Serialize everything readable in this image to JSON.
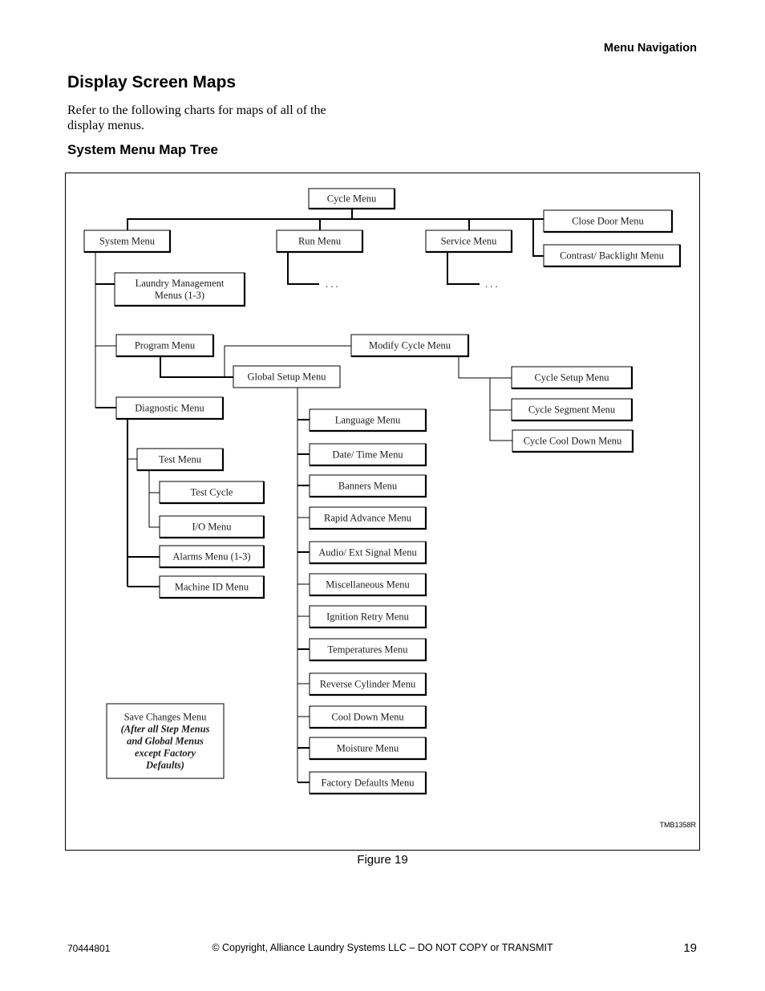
{
  "header": {
    "section": "Menu Navigation"
  },
  "page": {
    "title": "Display Screen Maps",
    "intro": "Refer to the following charts for maps of all of the display menus.",
    "subtitle": "System Menu Map Tree"
  },
  "diagram": {
    "figure_id": "TMB1358R",
    "caption": "Figure 19",
    "root": "Cycle Menu",
    "nodes": {
      "cycle_menu": "Cycle Menu",
      "system_menu": "System Menu",
      "run_menu": "Run Menu",
      "service_menu": "Service Menu",
      "close_door_menu": "Close Door Menu",
      "contrast_backlight_menu": "Contrast/ Backlight Menu",
      "run_ellipsis": ". . .",
      "service_ellipsis": ". . .",
      "laundry_mgmt_line1": "Laundry Management",
      "laundry_mgmt_line2": "Menus (1-3)",
      "program_menu": "Program Menu",
      "modify_cycle_menu": "Modify Cycle Menu",
      "global_setup_menu": "Global Setup Menu",
      "cycle_setup_menu": "Cycle Setup Menu",
      "cycle_segment_menu": "Cycle Segment Menu",
      "cycle_cool_down_menu": "Cycle Cool Down Menu",
      "diagnostic_menu": "Diagnostic Menu",
      "test_menu": "Test Menu",
      "test_cycle": "Test Cycle",
      "io_menu": "I/O Menu",
      "alarms_menu": "Alarms Menu (1-3)",
      "machine_id_menu": "Machine ID Menu"
    },
    "global_setup_children": [
      "Language Menu",
      "Date/ Time Menu",
      "Banners Menu",
      "Rapid Advance Menu",
      "Audio/ Ext Signal Menu",
      "Miscellaneous Menu",
      "Ignition Retry Menu",
      "Temperatures Menu",
      "Reverse Cylinder Menu",
      "Cool Down Menu",
      "Moisture Menu",
      "Factory Defaults Menu"
    ],
    "save_changes": {
      "title": "Save Changes Menu",
      "note_lines": [
        "(After all Step Menus",
        "and Global Menus",
        "except Factory",
        "Defaults)"
      ]
    }
  },
  "footer": {
    "doc_number": "70444801",
    "copyright": "© Copyright, Alliance Laundry Systems LLC – DO NOT COPY or TRANSMIT",
    "page_number": "19"
  }
}
